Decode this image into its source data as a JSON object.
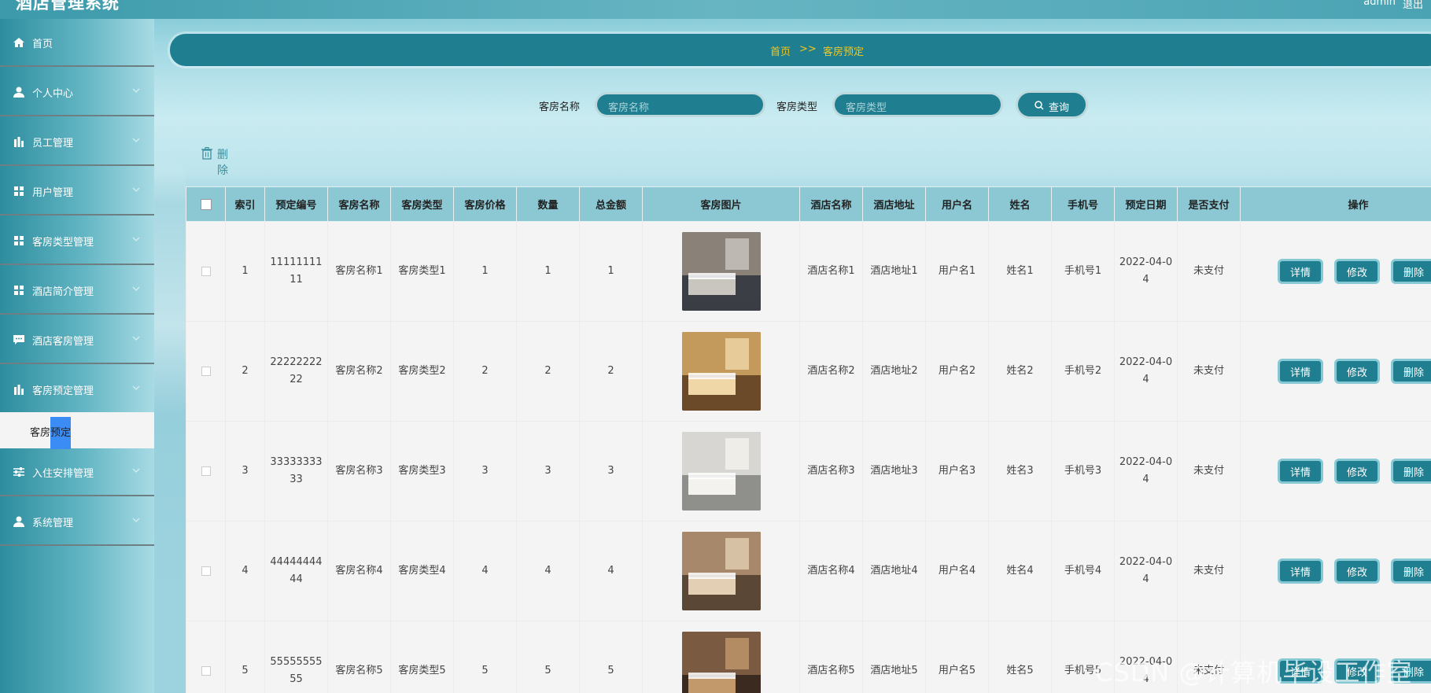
{
  "app": {
    "title": "酒店管理系统",
    "user": "admin",
    "logout": "退出"
  },
  "sidebar": {
    "items": [
      {
        "label": "首页",
        "icon": "home-icon",
        "has_children": false
      },
      {
        "label": "个人中心",
        "icon": "user-icon",
        "has_children": true
      },
      {
        "label": "员工管理",
        "icon": "bar-chart-icon",
        "has_children": true
      },
      {
        "label": "用户管理",
        "icon": "grid-icon",
        "has_children": true
      },
      {
        "label": "客房类型管理",
        "icon": "grid-icon",
        "has_children": true
      },
      {
        "label": "酒店简介管理",
        "icon": "grid-icon",
        "has_children": true
      },
      {
        "label": "酒店客房管理",
        "icon": "message-icon",
        "has_children": true
      },
      {
        "label": "客房预定管理",
        "icon": "bar-chart-icon",
        "has_children": true
      },
      {
        "label": "入住安排管理",
        "icon": "sliders-icon",
        "has_children": true
      },
      {
        "label": "系统管理",
        "icon": "user-icon",
        "has_children": true
      }
    ],
    "submenu": {
      "label_a": "客房",
      "label_b": "预定"
    }
  },
  "breadcrumb": {
    "home": "首页",
    "sep": ">>",
    "current": "客房预定"
  },
  "search": {
    "name_label": "客房名称",
    "name_placeholder": "客房名称",
    "type_label": "客房类型",
    "type_placeholder": "客房类型",
    "button": "查询"
  },
  "toolbar": {
    "delete": "删除"
  },
  "table": {
    "headers": [
      "索引",
      "预定编号",
      "客房名称",
      "客房类型",
      "客房价格",
      "数量",
      "总金额",
      "客房图片",
      "酒店名称",
      "酒店地址",
      "用户名",
      "姓名",
      "手机号",
      "预定日期",
      "是否支付",
      "操作"
    ],
    "actions": {
      "detail": "详情",
      "edit": "修改",
      "delete": "删除"
    },
    "rows": [
      {
        "index": "1",
        "code": "1111111111",
        "room_name": "客房名称1",
        "room_type": "客房类型1",
        "price": "1",
        "qty": "1",
        "total": "1",
        "hotel_name": "酒店名称1",
        "hotel_addr": "酒店地址1",
        "username": "用户名1",
        "name": "姓名1",
        "phone": "手机号1",
        "date": "2022-04-04",
        "paid": "未支付"
      },
      {
        "index": "2",
        "code": "2222222222",
        "room_name": "客房名称2",
        "room_type": "客房类型2",
        "price": "2",
        "qty": "2",
        "total": "2",
        "hotel_name": "酒店名称2",
        "hotel_addr": "酒店地址2",
        "username": "用户名2",
        "name": "姓名2",
        "phone": "手机号2",
        "date": "2022-04-04",
        "paid": "未支付"
      },
      {
        "index": "3",
        "code": "3333333333",
        "room_name": "客房名称3",
        "room_type": "客房类型3",
        "price": "3",
        "qty": "3",
        "total": "3",
        "hotel_name": "酒店名称3",
        "hotel_addr": "酒店地址3",
        "username": "用户名3",
        "name": "姓名3",
        "phone": "手机号3",
        "date": "2022-04-04",
        "paid": "未支付"
      },
      {
        "index": "4",
        "code": "4444444444",
        "room_name": "客房名称4",
        "room_type": "客房类型4",
        "price": "4",
        "qty": "4",
        "total": "4",
        "hotel_name": "酒店名称4",
        "hotel_addr": "酒店地址4",
        "username": "用户名4",
        "name": "姓名4",
        "phone": "手机号4",
        "date": "2022-04-04",
        "paid": "未支付"
      },
      {
        "index": "5",
        "code": "5555555555",
        "room_name": "客房名称5",
        "room_type": "客房类型5",
        "price": "5",
        "qty": "5",
        "total": "5",
        "hotel_name": "酒店名称5",
        "hotel_addr": "酒店地址5",
        "username": "用户名5",
        "name": "姓名5",
        "phone": "手机号5",
        "date": "2022-04-04",
        "paid": "未支付"
      }
    ]
  },
  "watermark": "CSDN @计算机毕设工作室",
  "colors": {
    "primary": "#1f7f90",
    "header": "#8bc8d4",
    "breadcrumb_text": "#f5c518",
    "highlight": "#3b8df5"
  }
}
